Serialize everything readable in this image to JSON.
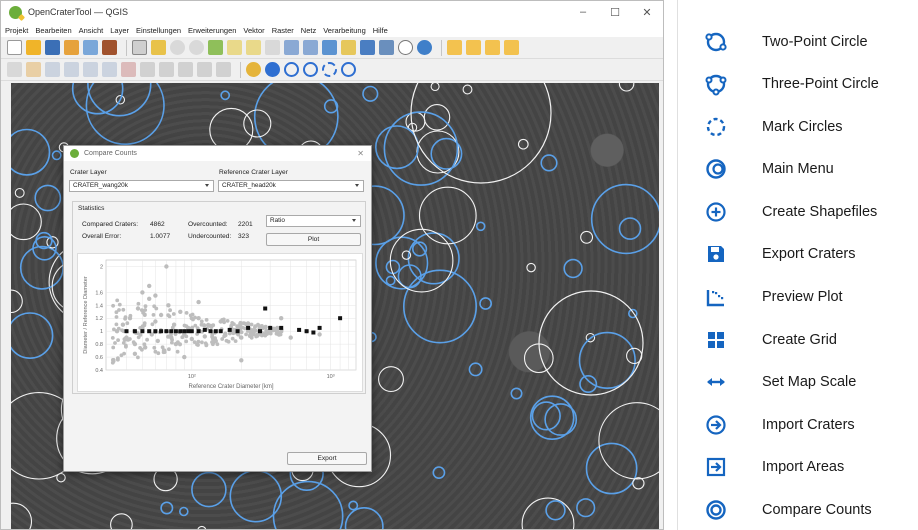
{
  "window": {
    "title": "OpenCraterTool — QGIS",
    "controls": [
      "–",
      "☐",
      "✕"
    ]
  },
  "menu": [
    "Projekt",
    "Bearbeiten",
    "Ansicht",
    "Layer",
    "Einstellungen",
    "Erweiterungen",
    "Vektor",
    "Raster",
    "Netz",
    "Verarbeitung",
    "Hilfe"
  ],
  "dialog": {
    "title": "Compare Counts",
    "close": "✕",
    "crater_layer_label": "Crater Layer",
    "crater_layer_value": "CRATER_wang20k",
    "reference_layer_label": "Reference Crater Layer",
    "reference_layer_value": "CRATER_head20k",
    "statistics_label": "Statistics",
    "compared_label": "Compared Craters:",
    "compared_value": "4862",
    "overcounted_label": "Overcounted:",
    "overcounted_value": "2201",
    "overall_error_label": "Overall Error:",
    "overall_error_value": "1.0077",
    "undercounted_label": "Undercounted:",
    "undercounted_value": "323",
    "mode_value": "Ratio",
    "plot_button": "Plot",
    "export_button": "Export"
  },
  "chart_data": {
    "type": "scatter",
    "xlabel": "Reference Crater Diameter [km]",
    "ylabel": "Diameter / Reference Diameter",
    "x_scale": "log",
    "x_tick_labels": [
      "10²",
      "10³"
    ],
    "y_tick_labels": [
      "0.4",
      "0.6",
      "0.8",
      "1",
      "1.2",
      "1.4",
      "1.6",
      "2"
    ],
    "ylim": [
      0.4,
      2.1
    ],
    "grid": true,
    "series": [
      {
        "marker": "gray-circle",
        "color": "#bdbdbd",
        "points": [
          [
            0.35,
            1.0
          ],
          [
            0.38,
            1.1
          ],
          [
            0.4,
            0.9
          ],
          [
            0.42,
            1.2
          ],
          [
            0.45,
            0.8
          ],
          [
            0.47,
            1.35
          ],
          [
            0.5,
            1.05
          ],
          [
            0.52,
            0.75
          ],
          [
            0.55,
            1.5
          ],
          [
            0.57,
            0.95
          ],
          [
            0.6,
            1.15
          ],
          [
            0.62,
            0.85
          ],
          [
            0.65,
            1.25
          ],
          [
            0.68,
            0.7
          ],
          [
            0.7,
            1.0
          ],
          [
            0.72,
            1.4
          ],
          [
            0.75,
            0.9
          ],
          [
            0.78,
            1.1
          ],
          [
            0.8,
            0.8
          ],
          [
            0.85,
            1.3
          ],
          [
            0.9,
            0.95
          ],
          [
            0.95,
            1.05
          ],
          [
            1.0,
            0.88
          ],
          [
            1.1,
            1.2
          ],
          [
            1.2,
            0.92
          ],
          [
            1.3,
            1.08
          ],
          [
            1.4,
            0.85
          ],
          [
            1.5,
            1.15
          ],
          [
            1.6,
            0.96
          ],
          [
            1.8,
            1.02
          ],
          [
            2.0,
            0.9
          ],
          [
            2.2,
            1.12
          ],
          [
            2.5,
            0.94
          ],
          [
            2.8,
            1.06
          ],
          [
            3.0,
            0.98
          ],
          [
            3.5,
            1.2
          ],
          [
            4.0,
            0.9
          ],
          [
            0.5,
            1.6
          ],
          [
            0.6,
            1.55
          ],
          [
            1.1,
            1.45
          ],
          [
            0.9,
            0.6
          ],
          [
            0.45,
            0.65
          ],
          [
            0.55,
            1.7
          ],
          [
            5.0,
            1.0
          ],
          [
            6.0,
            0.95
          ],
          [
            2.0,
            0.55
          ],
          [
            0.7,
            2.0
          ]
        ]
      },
      {
        "marker": "black-square",
        "color": "#111111",
        "points": [
          [
            0.4,
            1.0
          ],
          [
            0.45,
            1.0
          ],
          [
            0.5,
            1.0
          ],
          [
            0.55,
            1.0
          ],
          [
            0.6,
            1.0
          ],
          [
            0.65,
            1.0
          ],
          [
            0.7,
            1.0
          ],
          [
            0.75,
            1.0
          ],
          [
            0.8,
            1.0
          ],
          [
            0.85,
            1.0
          ],
          [
            0.9,
            1.0
          ],
          [
            0.95,
            1.0
          ],
          [
            1.0,
            1.0
          ],
          [
            1.1,
            1.0
          ],
          [
            1.2,
            1.02
          ],
          [
            1.3,
            1.0
          ],
          [
            1.4,
            1.0
          ],
          [
            1.5,
            1.0
          ],
          [
            1.7,
            1.02
          ],
          [
            1.9,
            1.0
          ],
          [
            2.2,
            1.05
          ],
          [
            2.6,
            1.0
          ],
          [
            2.8,
            1.35
          ],
          [
            3.0,
            1.05
          ],
          [
            3.5,
            1.05
          ],
          [
            4.5,
            1.02
          ],
          [
            5.0,
            1.0
          ],
          [
            5.5,
            0.98
          ],
          [
            6.0,
            1.05
          ],
          [
            8.0,
            1.2
          ]
        ]
      }
    ]
  },
  "legend": [
    {
      "label": "Two-Point Circle",
      "icon": "two-point-circle-icon"
    },
    {
      "label": "Three-Point Circle",
      "icon": "three-point-circle-icon"
    },
    {
      "label": "Mark Circles",
      "icon": "mark-circles-icon"
    },
    {
      "label": "Main Menu",
      "icon": "main-menu-icon"
    },
    {
      "label": "Create Shapefiles",
      "icon": "create-shapefiles-icon"
    },
    {
      "label": "Export Craters",
      "icon": "export-craters-icon"
    },
    {
      "label": "Preview Plot",
      "icon": "preview-plot-icon"
    },
    {
      "label": "Create Grid",
      "icon": "create-grid-icon"
    },
    {
      "label": "Set Map Scale",
      "icon": "set-map-scale-icon"
    },
    {
      "label": "Import Craters",
      "icon": "import-craters-icon"
    },
    {
      "label": "Import Areas",
      "icon": "import-areas-icon"
    },
    {
      "label": "Compare Counts",
      "icon": "compare-counts-icon"
    }
  ],
  "colors": {
    "accent": "#1565c0",
    "crater_blue": "#5aa0e8",
    "crater_white": "#f2f2f2"
  }
}
